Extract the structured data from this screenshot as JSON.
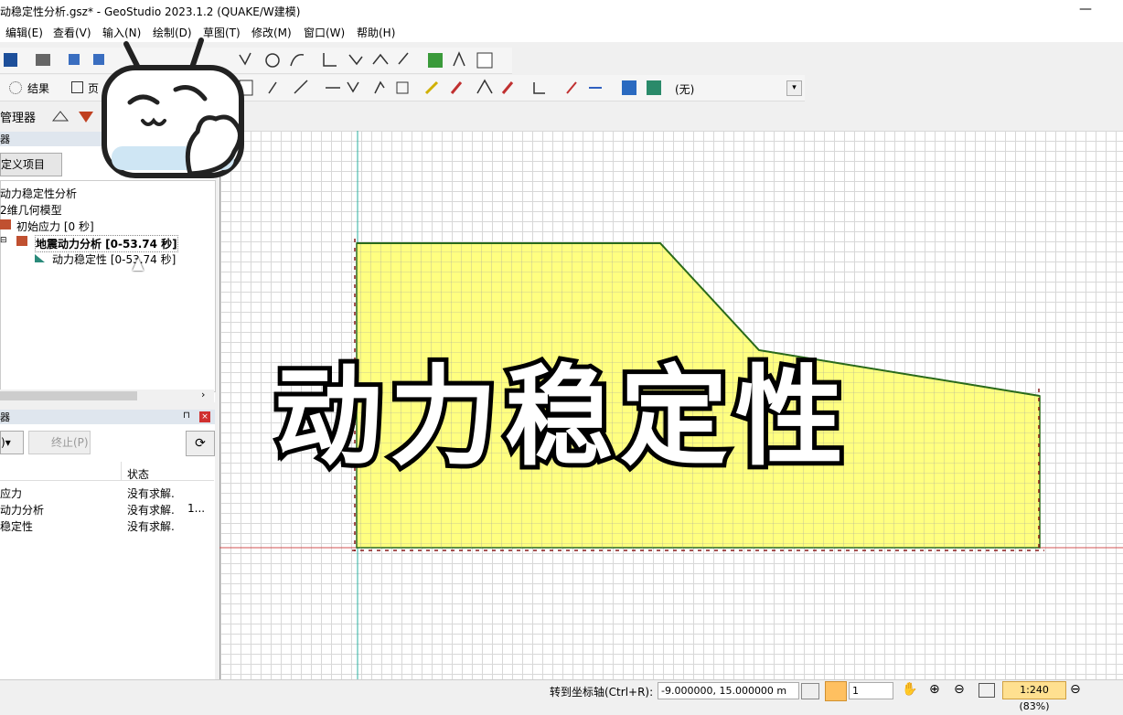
{
  "window": {
    "title": "动稳定性分析.gsz* - GeoStudio 2023.1.2 (QUAKE/W建模)",
    "minimize": "—"
  },
  "menu": [
    "编辑(E)",
    "查看(V)",
    "输入(N)",
    "绘制(D)",
    "草图(T)",
    "修改(M)",
    "窗口(W)",
    "帮助(H)"
  ],
  "toolbar2": {
    "results_label": "结果",
    "page_label": "页",
    "dropdown_value": "(无)"
  },
  "left": {
    "manager_label": "管理器",
    "panel1_header": "器",
    "define_button": "定义项目",
    "tree": [
      "动力稳定性分析",
      "2维几何模型",
      "初始应力 [0 秒]",
      "地震动力分析 [0-53.74 秒]",
      "动力稳定性 [0-53.74 秒]"
    ],
    "panel2_header": "器",
    "solve_button": ")",
    "stop_button": "终止(P)",
    "col_status": "状态",
    "rows": [
      {
        "name": "应力",
        "status": "没有求解.",
        "extra": ""
      },
      {
        "name": "动力分析",
        "status": "没有求解.",
        "extra": "1..."
      },
      {
        "name": "稳定性",
        "status": "没有求解.",
        "extra": ""
      }
    ]
  },
  "overlay_text": "动力稳定性",
  "status": {
    "goto_label": "转到坐标轴(Ctrl+R):",
    "coord_value": "-9.000000, 15.000000 m",
    "step_value": "1",
    "scale": "1:240 (83%)"
  },
  "colors": {
    "soil": "#ffff80",
    "crest": "#2a6a1a",
    "boundary": "#8a1a1a",
    "axis_v": "#2ab0a0",
    "axis_h": "#d05050",
    "scale_bg": "#ffe090"
  }
}
